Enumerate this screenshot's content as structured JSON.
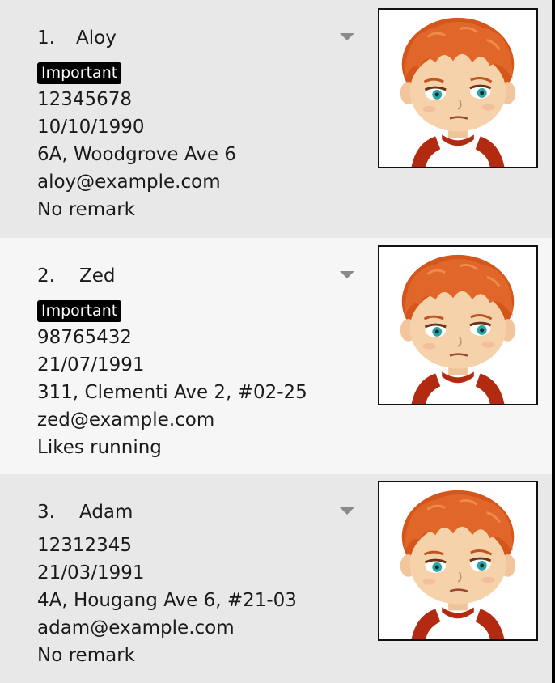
{
  "persons": [
    {
      "index": "1.",
      "name": "Aloy",
      "tag": "Important",
      "phone": "12345678",
      "birthday": "10/10/1990",
      "address": "6A, Woodgrove Ave 6",
      "email": "aloy@example.com",
      "remark": "No remark",
      "avatar_icon": "cartoon-boy-avatar"
    },
    {
      "index": "2.",
      "name": "Zed",
      "tag": "Important",
      "phone": "98765432",
      "birthday": "21/07/1991",
      "address": "311, Clementi Ave 2, #02-25",
      "email": "zed@example.com",
      "remark": "Likes running",
      "avatar_icon": "cartoon-boy-avatar"
    },
    {
      "index": "3.",
      "name": "Adam",
      "tag": "",
      "phone": "12312345",
      "birthday": "21/03/1991",
      "address": "4A, Hougang Ave 6, #21-03",
      "email": "adam@example.com",
      "remark": "No remark",
      "avatar_icon": "cartoon-boy-avatar"
    }
  ],
  "colors": {
    "tag_background": "#000000",
    "tag_text": "#ffffff",
    "hair": "#d4561a",
    "shirt_sleeve": "#b22a10"
  }
}
